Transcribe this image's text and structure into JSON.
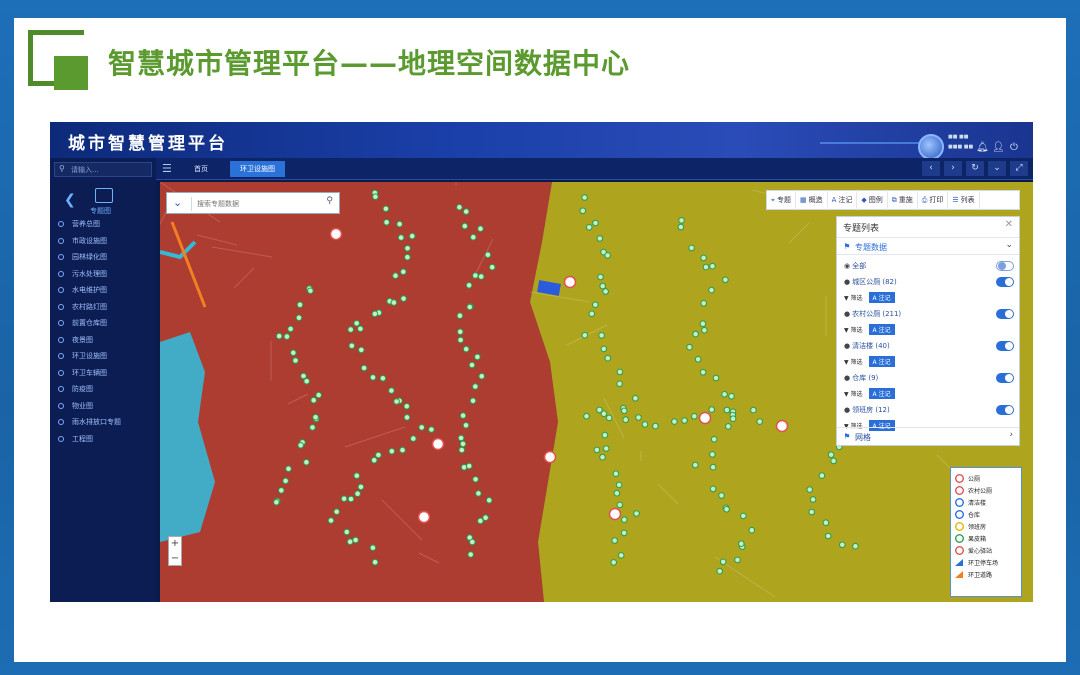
{
  "slide": {
    "title": "智慧城市管理平台——地理空间数据中心",
    "colors": {
      "accent": "#5b9a2f",
      "frame": "#1d6fb8"
    }
  },
  "app": {
    "title": "城市智慧管理平台",
    "user": {
      "line1": "■■ ■■",
      "line2": "■■■ ■■"
    },
    "header_icons": [
      "bell-icon",
      "user-icon",
      "power-icon"
    ]
  },
  "sidebar": {
    "search_placeholder": "请输入...",
    "theme_label": "专题图",
    "items": [
      {
        "label": "营养总图"
      },
      {
        "label": "市政设施图"
      },
      {
        "label": "园林绿化图"
      },
      {
        "label": "污水处理图"
      },
      {
        "label": "水电维护图"
      },
      {
        "label": "农村路灯图"
      },
      {
        "label": "前置仓库图"
      },
      {
        "label": "夜景图"
      },
      {
        "label": "环卫设施图"
      },
      {
        "label": "环卫车辆图"
      },
      {
        "label": "防疫图"
      },
      {
        "label": "物业图"
      },
      {
        "label": "雨水排放口专题"
      },
      {
        "label": "工程图"
      }
    ]
  },
  "tabs": {
    "items": [
      {
        "label": "首页"
      },
      {
        "label": "环卫设施图"
      }
    ],
    "active": "环卫设施图"
  },
  "map": {
    "search_placeholder": "搜索专题数据",
    "zoom_in": "+",
    "zoom_out": "−",
    "toolbar": [
      {
        "label": "专题",
        "icon": "target-icon"
      },
      {
        "label": "概造",
        "icon": "grid-icon"
      },
      {
        "label": "注记",
        "icon": "text-icon"
      },
      {
        "label": "图例",
        "icon": "tag-icon"
      },
      {
        "label": "重施",
        "icon": "crop-icon"
      },
      {
        "label": "打印",
        "icon": "printer-icon"
      },
      {
        "label": "列表",
        "icon": "list-icon"
      }
    ],
    "panel": {
      "title": "专题列表",
      "section": "专题数据",
      "all_label": "全部",
      "filter_label": "筛选",
      "annotation_label": "注记",
      "layers": [
        {
          "name": "城区公厕",
          "count": "(82)",
          "on": true
        },
        {
          "name": "农村公厕",
          "count": "(211)",
          "on": true
        },
        {
          "name": "清洁楼",
          "count": "(40)",
          "on": true
        },
        {
          "name": "仓库",
          "count": "(9)",
          "on": true
        },
        {
          "name": "领班房",
          "count": "(12)",
          "on": true
        }
      ],
      "grid_label": "网格"
    },
    "legend": [
      {
        "label": "公厕",
        "color": "#e05050"
      },
      {
        "label": "农村公厕",
        "color": "#e05050"
      },
      {
        "label": "清洁楼",
        "color": "#2a6fd8"
      },
      {
        "label": "仓库",
        "color": "#2a6fd8"
      },
      {
        "label": "领班房",
        "color": "#e8b400"
      },
      {
        "label": "果皮箱",
        "color": "#2aa050"
      },
      {
        "label": "爱心驿站",
        "color": "#e05050"
      },
      {
        "label": "环卫停车场",
        "color": "#2a6fd8"
      },
      {
        "label": "环卫道路",
        "color": "#f08020"
      }
    ],
    "zone_colors": {
      "west": "#c23a30",
      "east": "#c8b818",
      "water": "#36b8d8"
    }
  }
}
